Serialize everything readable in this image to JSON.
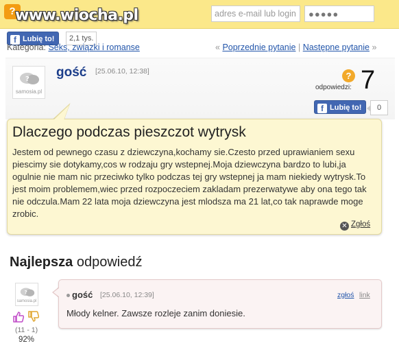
{
  "header": {
    "watermark": "www.wiocha.pl",
    "logo_badge": "?",
    "email_placeholder": "adres e-mail lub login",
    "password_value": "●●●●●"
  },
  "like_top": {
    "label": "Lubię to!",
    "count": "2,1 tys."
  },
  "category": {
    "prefix": "Kategoria:",
    "link": "Seks, związki i romanse"
  },
  "nav": {
    "prev_arrow": "«",
    "prev": "Poprzednie pytanie",
    "separator": "|",
    "next": "Następne pytanie",
    "next_arrow": "»"
  },
  "question": {
    "author": "gość",
    "date": "[25.06.10, 12:38]",
    "avatar_caption": "samosia.pl",
    "answers_label": "odpowiedzi:",
    "answers_count": "7",
    "like_label": "Lubię to!",
    "like_count": "0",
    "title": "Dlaczego podczas pieszczot wytrysk",
    "body": "Jestem od pewnego czasu z dziewczyna,kochamy sie.Czesto przed uprawianiem sexu piescimy sie dotykamy,cos w rodzaju gry wstepnej.Moja dziewczyna bardzo to lubi,ja ogulnie nie mam nic przeciwko tylko podczas tej gry wstepnej ja mam niekiedy wytrysk.To jest moim problemem,wiec przed rozpoczeciem zakladam prezerwatywe aby ona tego tak nie odczula.Mam 22 lata moja dziewczyna jest mlodsza ma 21 lat,co tak naprawde moge zrobic.",
    "report": "Zgłoś"
  },
  "best_answer": {
    "heading_bold": "Najlepsza",
    "heading_rest": "odpowiedź",
    "author": "gość",
    "date": "[25.06.10, 12:39]",
    "avatar_caption": "samosia.pl",
    "report": "zgłoś",
    "link": "link",
    "text": "Młody kelner. Zawsze rozleje zanim doniesie.",
    "tally": "(11 - 1)",
    "percent": "92%"
  },
  "colors": {
    "topbar": "#fbe88a",
    "facebook": "#4267b2",
    "question_box": "#fdf7d2",
    "answer_box": "#fbf3f3",
    "author_blue": "#1b3d8a"
  }
}
